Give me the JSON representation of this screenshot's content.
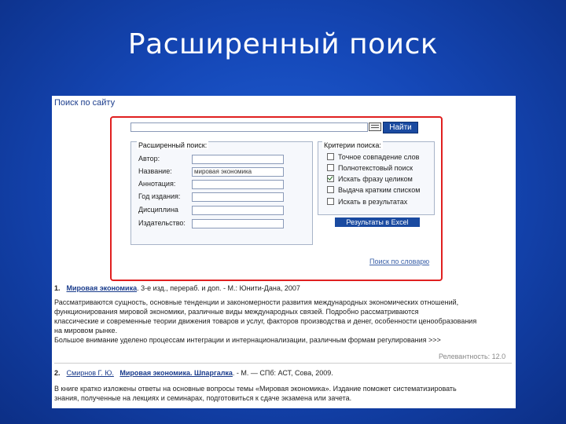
{
  "slide": {
    "title": "Расширенный поиск"
  },
  "site": {
    "title": "Поиск по сайту",
    "search_button": "Найти",
    "advanced": {
      "title": "Расширенный поиск:",
      "fields": [
        {
          "label": "Автор:",
          "value": ""
        },
        {
          "label": "Название:",
          "value": "мировая экономика"
        },
        {
          "label": "Аннотация:",
          "value": ""
        },
        {
          "label": "Год издания:",
          "value": ""
        },
        {
          "label": "Дисциплина",
          "value": ""
        },
        {
          "label": "Издательство:",
          "value": ""
        }
      ]
    },
    "criteria": {
      "title": "Критерии поиска:",
      "options": [
        {
          "label": "Точное совпадение слов",
          "checked": false
        },
        {
          "label": "Полнотекстовый поиск",
          "checked": false
        },
        {
          "label": "Искать фразу целиком",
          "checked": true
        },
        {
          "label": "Выдача кратким списком",
          "checked": false
        },
        {
          "label": "Искать в результатах",
          "checked": false
        }
      ]
    },
    "excel_button": "Результаты в Excel",
    "vocabulary_link": "Поиск по словарю"
  },
  "results": [
    {
      "num": "1.",
      "author": "",
      "title": "Мировая экономика",
      "info": ". 3-е изд., перераб. и доп. - М.: Юнити-Дана, 2007",
      "lines": [
        "Рассматриваются сущность, основные тенденции и закономерности развития международных экономических отношений,",
        "функционирования мировой экономики, различные виды международных связей. Подробно рассматриваются",
        "классические и современные теории движения товаров и услуг, факторов производства и денег, особенности ценообразования",
        "на мировом рынке.",
        "Большое внимание уделено процессам интеграции и интернационализации, различным формам регулирования >>>"
      ],
      "relevance": "Релевантность: 12.0"
    },
    {
      "num": "2.",
      "author": "Смирнов Г. Ю.",
      "title": "Мировая экономика. Шпаргалка",
      "info": ". - М. — СПб: АСТ, Сова, 2009.",
      "lines": [
        "В книге кратко изложены ответы на основные вопросы темы «Мировая экономика». Издание поможет систематизировать",
        "знания, полученные на лекциях и семинарах, подготовиться к сдаче экзамена или зачета."
      ],
      "relevance": ""
    }
  ]
}
